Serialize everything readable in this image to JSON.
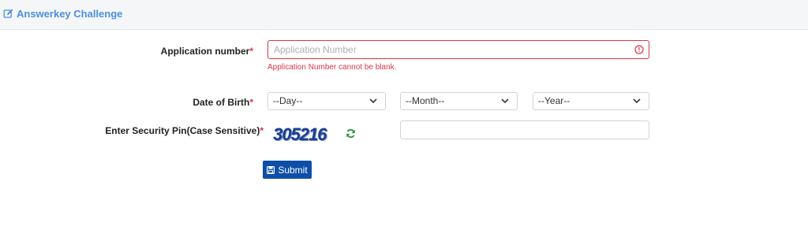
{
  "header": {
    "title": "Answerkey Challenge",
    "icon": "edit-icon"
  },
  "form": {
    "application_label": "Application number",
    "application_placeholder": "Application Number",
    "application_error": "Application Number cannot be blank.",
    "dob_label": "Date of Birth",
    "day_value": "--Day--",
    "month_value": "--Month--",
    "year_value": "--Year--",
    "pin_label": "Enter Security Pin(Case Sensitive)",
    "captcha_text": "305216",
    "required_mark": "*",
    "submit_label": "Submit"
  },
  "colors": {
    "accent": "#4a90e2",
    "error": "#dc3545",
    "button": "#0d4fa8",
    "refresh": "#2e9a3a"
  }
}
